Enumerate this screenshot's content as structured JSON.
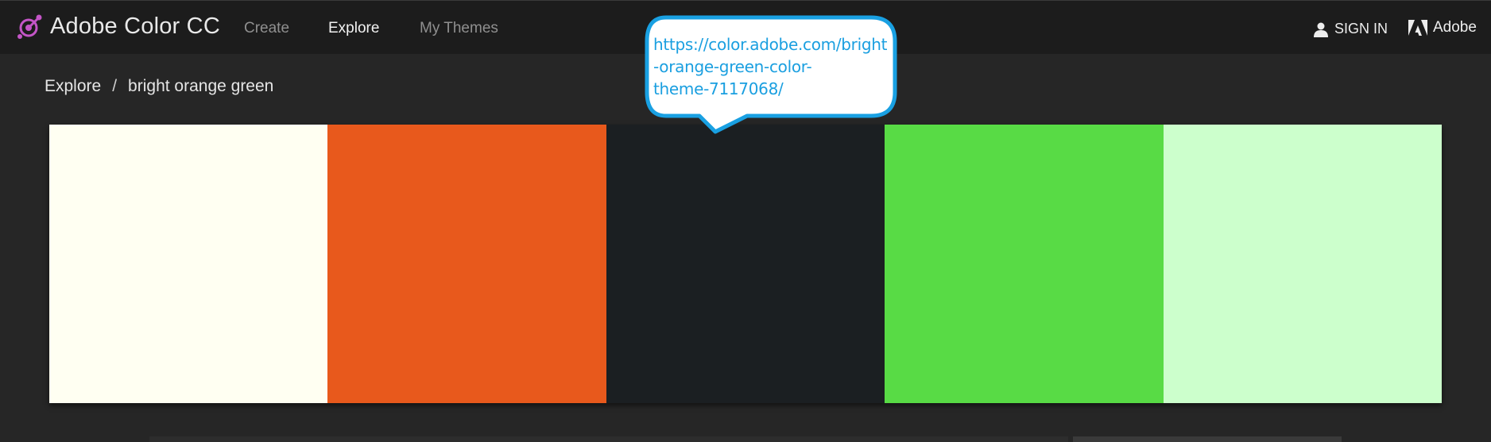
{
  "app": {
    "name": "Adobe Color CC",
    "icon": "adobe-color-logo-icon",
    "accent_color": "#c455c7"
  },
  "nav": {
    "items": [
      {
        "label": "Create",
        "active": false
      },
      {
        "label": "Explore",
        "active": true
      },
      {
        "label": "My Themes",
        "active": false
      }
    ]
  },
  "account": {
    "signin_label": "SIGN IN",
    "signin_icon": "user-icon",
    "adobe_label": "Adobe",
    "adobe_icon": "adobe-logo-icon"
  },
  "breadcrumb": {
    "root": "Explore",
    "separator": "/",
    "current": "bright orange green"
  },
  "theme": {
    "swatches": [
      {
        "color": "#FFFFF2"
      },
      {
        "color": "#E8591C"
      },
      {
        "color": "#1B1F22"
      },
      {
        "color": "#58DB45"
      },
      {
        "color": "#CCFFCC"
      }
    ]
  },
  "callout": {
    "lines": [
      "https://color.adobe.com/bright",
      "-orange-green-color-",
      "theme-7117068/"
    ],
    "text_color": "#1a9fe0",
    "border_color": "#19a0e2"
  }
}
